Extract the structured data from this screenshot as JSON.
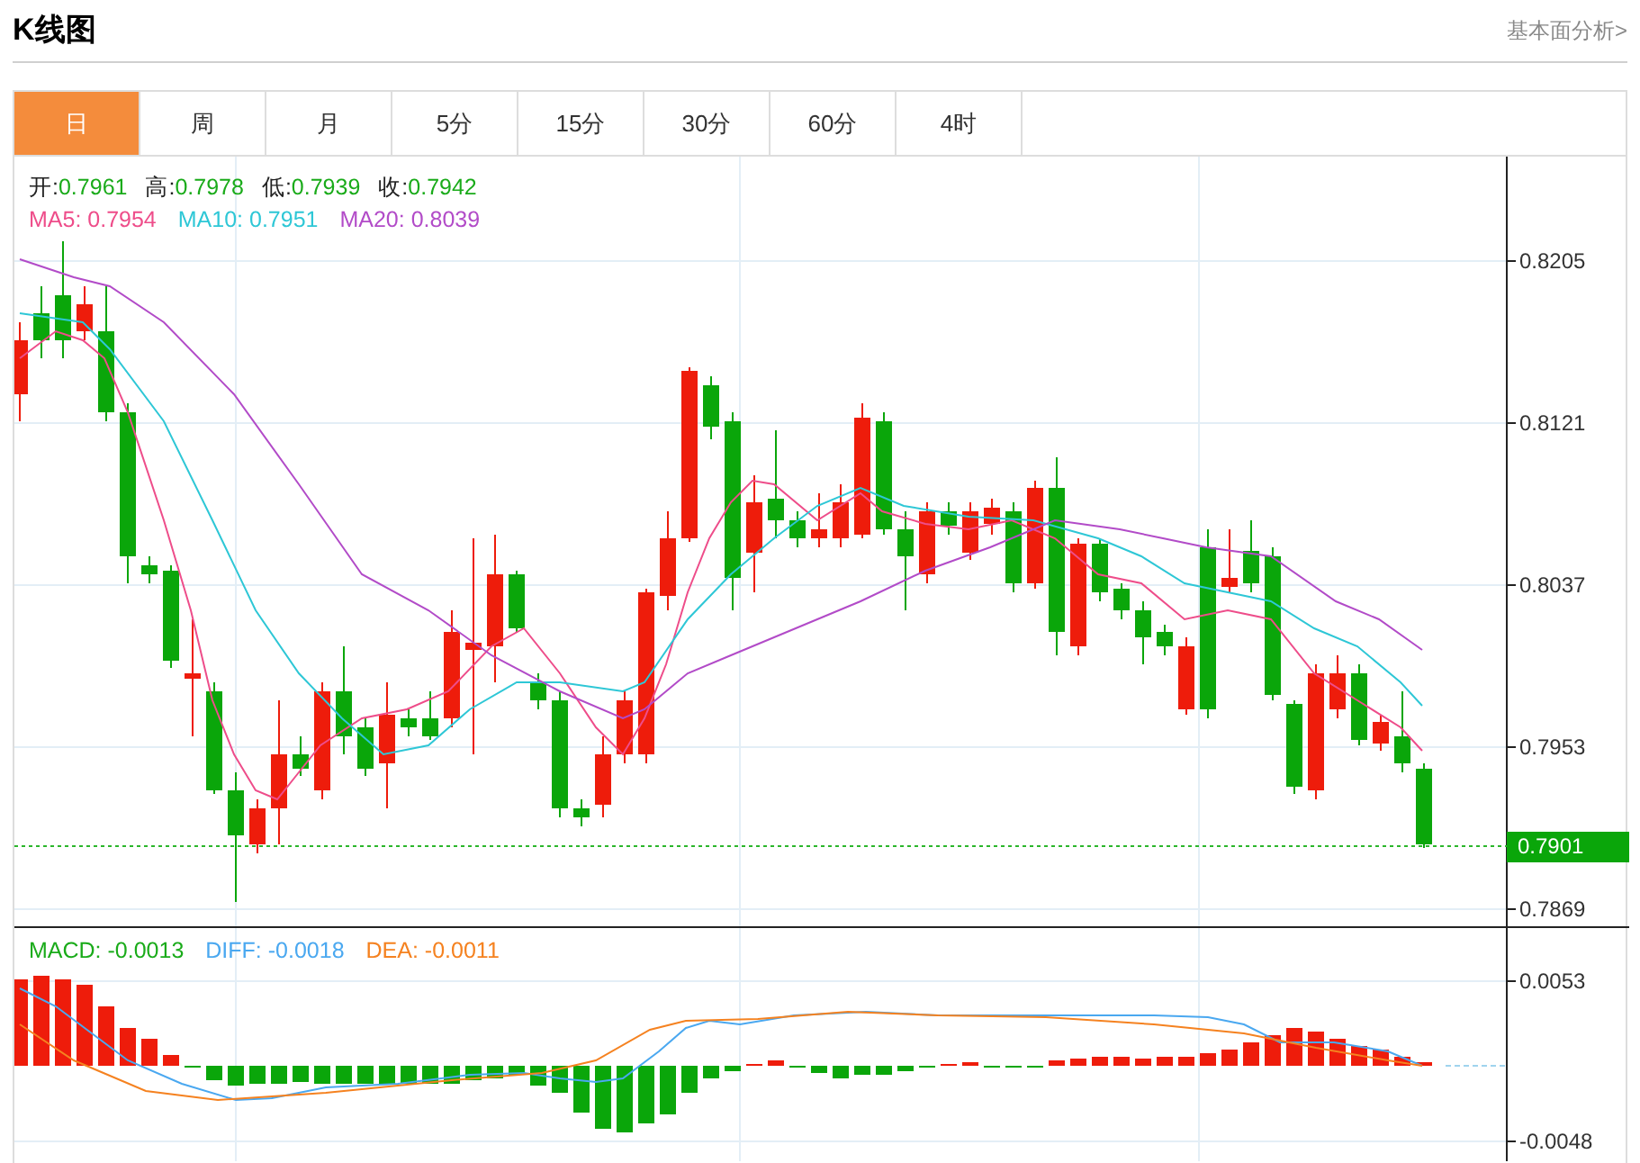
{
  "header": {
    "title": "K线图",
    "link": "基本面分析>"
  },
  "tabs": [
    {
      "label": "日",
      "selected": true
    },
    {
      "label": "周",
      "selected": false
    },
    {
      "label": "月",
      "selected": false
    },
    {
      "label": "5分",
      "selected": false
    },
    {
      "label": "15分",
      "selected": false
    },
    {
      "label": "30分",
      "selected": false
    },
    {
      "label": "60分",
      "selected": false
    },
    {
      "label": "4时",
      "selected": false
    }
  ],
  "ohlc": [
    {
      "label": "开:",
      "value": "0.7961"
    },
    {
      "label": "高:",
      "value": "0.7978"
    },
    {
      "label": "低:",
      "value": "0.7939"
    },
    {
      "label": "收:",
      "value": "0.7942"
    }
  ],
  "ma": [
    {
      "label": "MA5: 0.7954",
      "color": "#ee4d8a"
    },
    {
      "label": "MA10: 0.7951",
      "color": "#2ec7d6"
    },
    {
      "label": "MA20: 0.8039",
      "color": "#b24bc8"
    }
  ],
  "price_axis": [
    "0.8205",
    "0.8121",
    "0.8037",
    "0.7953",
    "0.7869"
  ],
  "last_price": "0.7901",
  "macd_legend": [
    {
      "label": "MACD: -0.0013",
      "color": "#1aab1a"
    },
    {
      "label": "DIFF: -0.0018",
      "color": "#4aa8f0"
    },
    {
      "label": "DEA: -0.0011",
      "color": "#f58220"
    }
  ],
  "macd_axis": [
    "0.0053",
    "-0.0048"
  ]
}
